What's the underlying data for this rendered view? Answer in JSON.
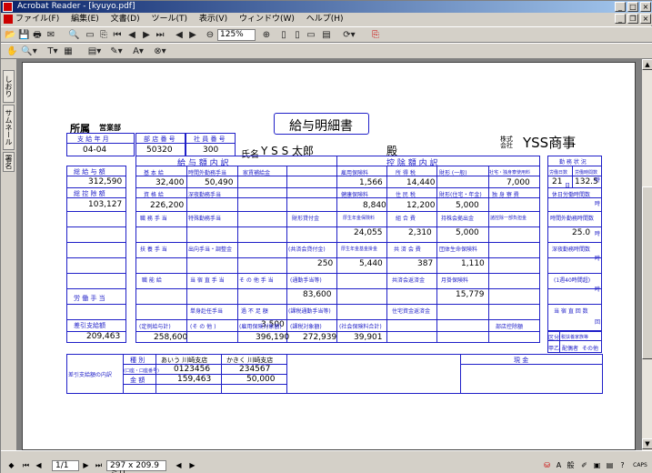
{
  "window": {
    "title": "Acrobat Reader - [kyuyo.pdf]",
    "min": "_",
    "max": "□",
    "close": "×"
  },
  "menu": [
    "ファイル(F)",
    "編集(E)",
    "文書(D)",
    "ツール(T)",
    "表示(V)",
    "ウィンドウ(W)",
    "ヘルプ(H)"
  ],
  "toolbar": {
    "zoom": "125%"
  },
  "sidetabs": [
    "しおり",
    "サムネール",
    "署名"
  ],
  "status": {
    "page": "1/1",
    "size": "297 x 209.9 ミリ"
  },
  "doc": {
    "title": "給与明細書",
    "shozoku_label": "所属",
    "shozoku_value": "営業部",
    "pay_month_label": "支 給 年 月",
    "pay_month": "04-04",
    "dept_no_label": "部 店 番 号",
    "dept_no": "50320",
    "emp_no_label": "社 員 番 号",
    "emp_no": "300",
    "name_label": "氏名",
    "name": "Y S S 太郎",
    "dono": "殿",
    "company_prefix": "株式\n会社",
    "company": "YSS商事",
    "kyuyo_header": "給 与 額 内 訳",
    "kojo_header": "控 除 額 内 訳",
    "kinmu_header": "勤 務 状 況",
    "summary": {
      "sogaku_label": "総 給 与 額",
      "sogaku": "312,590",
      "kojo_label": "総 控 除 額",
      "kojo": "103,127",
      "shoyo_label": "労 働 手 当",
      "sashihiki_label": "差引支給額",
      "sashihiki": "209,463"
    },
    "pay": {
      "kihon_label": "基 本 給",
      "kihon": "32,400",
      "jikangai_label": "時間外勤務手当",
      "jikangai": "50,490",
      "kazoku_label": "家賃補給金",
      "shikaku_label": "資 格 給",
      "shikaku": "226,200",
      "shinya_label": "深夜勤務手当",
      "shokumu_label": "職 務 手 当",
      "tokushu_label": "特殊勤務手当",
      "kyouiku_label": "扶 養 手 当",
      "tsukin_label": "出向手当・調整金",
      "koutsu_label": "職 能 給",
      "tousei_label": "当 宿 直 手 当",
      "sonota_label": "そ の 他 手 当",
      "tanshin_label": "単身赴任手当",
      "kabusoku_label": "過 不 足 額",
      "kabusoku": "3,500",
      "teigaku_label": "(定例給与計)",
      "teigaku": "258,600",
      "sonota2_label": "(そ の 他 )",
      "koyo_label": "(雇用保険対象額)",
      "koyo": "396,190",
      "kazei_label": "(課税対象額)",
      "kazei": "272,939",
      "shakai_label": "(社会保険料合計)",
      "shakai": "39,901"
    },
    "ded": {
      "koyohoken_label": "雇用保険料",
      "koyohoken": "1,566",
      "shotoku_label": "所 得 税",
      "shotoku": "14,440",
      "zaikei1_label": "財形 (一般)",
      "kyosai_label": "社宅・独身寮使用料",
      "kyosai": "7,000",
      "kenko_label": "健康保険料",
      "kenko": "8,840",
      "jumin_label": "住 民 税",
      "jumin": "12,200",
      "zaikei2_label": "財形(住宅・年金)",
      "zaikei2": "5,000",
      "dokushin_label": "独 身 寮 費",
      "zaikeisho_label": "財形貸付金",
      "kosei_label": "厚生年金保険料",
      "kosei": "24,055",
      "kumiai_label": "組 合 費",
      "kumiai": "2,310",
      "mochikabu_label": "持株会拠出金",
      "mochikabu": "5,000",
      "chosei_label": "諸控除一部負担金",
      "jutaku_label": "(共済会貸付金)",
      "jutaku": "250",
      "kousei2_label": "厚生年金基金掛金",
      "kousei2": "5,440",
      "kyosai2_label": "共 済 会 費",
      "kyosai2": "387",
      "dantai_label": "団体生命保険料",
      "dantai": "1,110",
      "tsukin2_label": "(通勤手当等)",
      "tsukin2": "83,600",
      "kyosai3_label": "共済会返済金",
      "tsumitate_label": "月掛保険料",
      "tsumitate": "15,779",
      "tsukin3_label": "(課税通勤手当等)",
      "juutaku_label": "住宅資金返済金",
      "bushoku_label": "部店控除額"
    },
    "kinmu": {
      "rodo_label": "労働日数",
      "rodo": "21",
      "rodojikan_label": "労働時間数",
      "rodojikan": "132.5",
      "ji": "時",
      "nichi": "日",
      "kyujitsu_label": "休日労働時間数",
      "jikangai_label": "時間外勤務時間数",
      "jikangai": "25.0",
      "shinya_label": "深夜勤務時間数",
      "ichishu_label": "(1週40時間超)",
      "toshuku_label": "当 宿 直 回 数",
      "kai": "回",
      "kubun_label": "区分",
      "kubun_sub": "税扶養家族等",
      "otsu_label": "甲乙",
      "haigu_label": "配偶者",
      "sonota_label": "その他"
    },
    "bank": {
      "section_label": "差引支給額の内訳",
      "shubetsu_label": "種 別",
      "bank1": "あいう 川崎支店",
      "bank2": "かきく 川崎支店",
      "kouza_label": "(口座・口座番号)",
      "kouza1": "0123456",
      "kouza2": "234567",
      "kingaku_label": "金 額",
      "amount1": "159,463",
      "amount2": "50,000",
      "genkin_label": "現 金"
    }
  }
}
